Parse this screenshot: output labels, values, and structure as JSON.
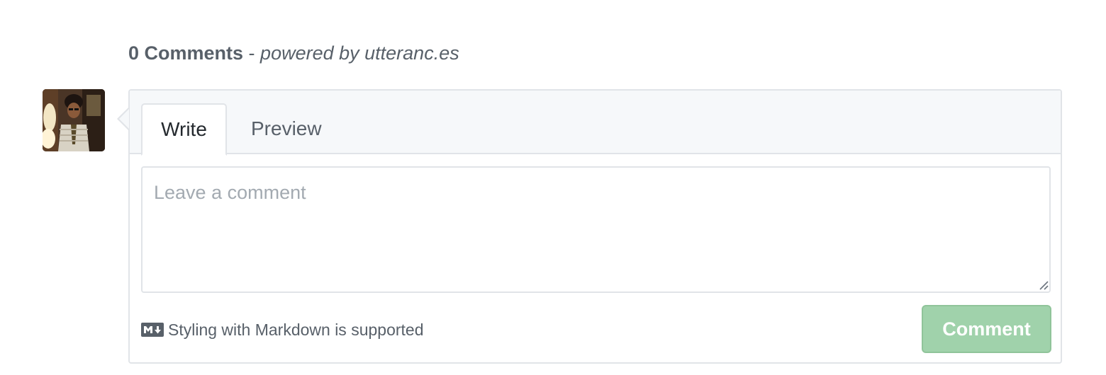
{
  "header": {
    "count_label": "0 Comments",
    "separator": " - ",
    "powered_label": "powered by utteranc.es"
  },
  "avatar": {
    "icon": "user-avatar-photo"
  },
  "editor": {
    "tabs": [
      {
        "label": "Write",
        "selected": true
      },
      {
        "label": "Preview",
        "selected": false
      }
    ],
    "textarea": {
      "value": "",
      "placeholder": "Leave a comment"
    },
    "markdown_note": "Styling with Markdown is supported",
    "markdown_icon": "markdown-icon",
    "submit_label": "Comment",
    "submit_disabled": true
  },
  "colors": {
    "border": "#e1e4e8",
    "tabbar_bg": "#f6f8fa",
    "muted_text": "#586069",
    "button_bg_disabled": "#a0d2ab",
    "button_border_disabled": "#90c49a"
  }
}
